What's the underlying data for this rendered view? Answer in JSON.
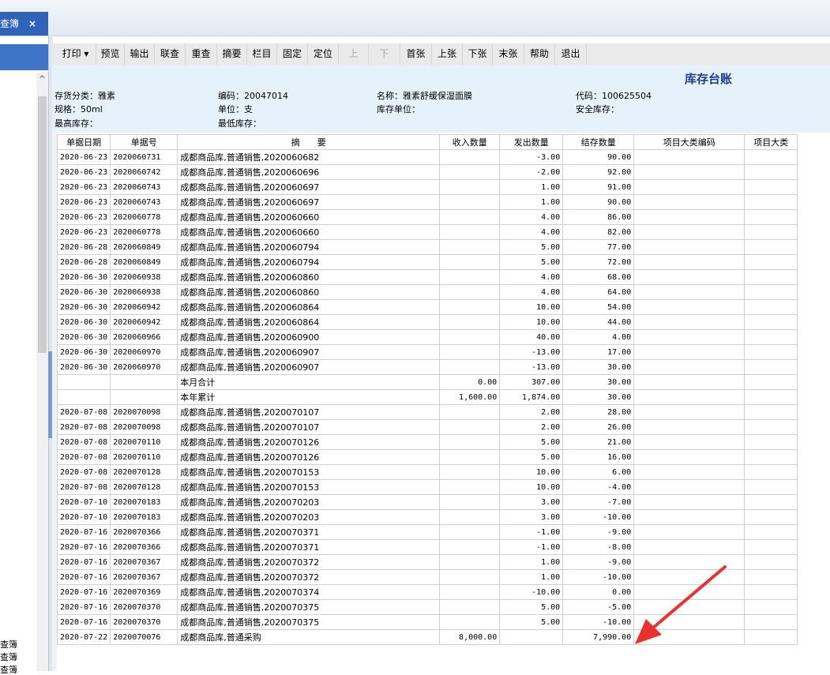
{
  "tab": {
    "label": "查簿",
    "close": "×"
  },
  "left_panel": {
    "items": [
      "查簿",
      "查簿",
      "查簿"
    ]
  },
  "toolbar": [
    {
      "label": "打印 ▾",
      "enabled": true
    },
    {
      "label": "预览",
      "enabled": true
    },
    {
      "label": "输出",
      "enabled": true
    },
    {
      "label": "联查",
      "enabled": true
    },
    {
      "label": "重查",
      "enabled": true
    },
    {
      "label": "摘要",
      "enabled": true
    },
    {
      "label": "栏目",
      "enabled": true
    },
    {
      "label": "固定",
      "enabled": true
    },
    {
      "label": "定位",
      "enabled": true
    },
    {
      "label": "上",
      "enabled": false
    },
    {
      "label": "下",
      "enabled": false
    },
    {
      "label": "首张",
      "enabled": true
    },
    {
      "label": "上张",
      "enabled": true
    },
    {
      "label": "下张",
      "enabled": true
    },
    {
      "label": "末张",
      "enabled": true
    },
    {
      "label": "帮助",
      "enabled": true
    },
    {
      "label": "退出",
      "enabled": true
    }
  ],
  "header": {
    "title": "库存台账",
    "category": "存货分类：雅素",
    "code": "编码：20047014",
    "name": "名称：雅素舒缓保湿面膜",
    "daima": "代码：100625504",
    "spec": "规格：50ml",
    "unit": "单位：支",
    "stock_unit": "库存单位：",
    "safety_stock": "安全库存：",
    "max_stock": "最高库存：",
    "min_stock": "最低库存："
  },
  "table": {
    "columns": [
      "单据日期",
      "单据号",
      "摘　　要",
      "收入数量",
      "发出数量",
      "结存数量",
      "项目大类编码",
      "项目大类"
    ],
    "rows": [
      [
        "2020-06-23",
        "2020060731",
        "成都商品库,普通销售,2020060682",
        "",
        "-3.00",
        "90.00",
        "",
        ""
      ],
      [
        "2020-06-23",
        "2020060742",
        "成都商品库,普通销售,2020060696",
        "",
        "-2.00",
        "92.00",
        "",
        ""
      ],
      [
        "2020-06-23",
        "2020060743",
        "成都商品库,普通销售,2020060697",
        "",
        "1.00",
        "91.00",
        "",
        ""
      ],
      [
        "2020-06-23",
        "2020060743",
        "成都商品库,普通销售,2020060697",
        "",
        "1.00",
        "90.00",
        "",
        ""
      ],
      [
        "2020-06-23",
        "2020060778",
        "成都商品库,普通销售,2020060660",
        "",
        "4.00",
        "86.00",
        "",
        ""
      ],
      [
        "2020-06-23",
        "2020060778",
        "成都商品库,普通销售,2020060660",
        "",
        "4.00",
        "82.00",
        "",
        ""
      ],
      [
        "2020-06-28",
        "2020060849",
        "成都商品库,普通销售,2020060794",
        "",
        "5.00",
        "77.00",
        "",
        ""
      ],
      [
        "2020-06-28",
        "2020060849",
        "成都商品库,普通销售,2020060794",
        "",
        "5.00",
        "72.00",
        "",
        ""
      ],
      [
        "2020-06-30",
        "2020060938",
        "成都商品库,普通销售,2020060860",
        "",
        "4.00",
        "68.00",
        "",
        ""
      ],
      [
        "2020-06-30",
        "2020060938",
        "成都商品库,普通销售,2020060860",
        "",
        "4.00",
        "64.00",
        "",
        ""
      ],
      [
        "2020-06-30",
        "2020060942",
        "成都商品库,普通销售,2020060864",
        "",
        "10.00",
        "54.00",
        "",
        ""
      ],
      [
        "2020-06-30",
        "2020060942",
        "成都商品库,普通销售,2020060864",
        "",
        "10.00",
        "44.00",
        "",
        ""
      ],
      [
        "2020-06-30",
        "2020060966",
        "成都商品库,普通销售,2020060900",
        "",
        "40.00",
        "4.00",
        "",
        ""
      ],
      [
        "2020-06-30",
        "2020060970",
        "成都商品库,普通销售,2020060907",
        "",
        "-13.00",
        "17.00",
        "",
        ""
      ],
      [
        "2020-06-30",
        "2020060970",
        "成都商品库,普通销售,2020060907",
        "",
        "-13.00",
        "30.00",
        "",
        ""
      ],
      [
        "",
        "",
        "本月合计",
        "0.00",
        "307.00",
        "30.00",
        "",
        ""
      ],
      [
        "",
        "",
        "本年累计",
        "1,600.00",
        "1,874.00",
        "30.00",
        "",
        ""
      ],
      [
        "2020-07-08",
        "2020070098",
        "成都商品库,普通销售,2020070107",
        "",
        "2.00",
        "28.00",
        "",
        ""
      ],
      [
        "2020-07-08",
        "2020070098",
        "成都商品库,普通销售,2020070107",
        "",
        "2.00",
        "26.00",
        "",
        ""
      ],
      [
        "2020-07-08",
        "2020070110",
        "成都商品库,普通销售,2020070126",
        "",
        "5.00",
        "21.00",
        "",
        ""
      ],
      [
        "2020-07-08",
        "2020070110",
        "成都商品库,普通销售,2020070126",
        "",
        "5.00",
        "16.00",
        "",
        ""
      ],
      [
        "2020-07-08",
        "2020070128",
        "成都商品库,普通销售,2020070153",
        "",
        "10.00",
        "6.00",
        "",
        ""
      ],
      [
        "2020-07-08",
        "2020070128",
        "成都商品库,普通销售,2020070153",
        "",
        "10.00",
        "-4.00",
        "",
        ""
      ],
      [
        "2020-07-10",
        "2020070183",
        "成都商品库,普通销售,2020070203",
        "",
        "3.00",
        "-7.00",
        "",
        ""
      ],
      [
        "2020-07-10",
        "2020070183",
        "成都商品库,普通销售,2020070203",
        "",
        "3.00",
        "-10.00",
        "",
        ""
      ],
      [
        "2020-07-16",
        "2020070366",
        "成都商品库,普通销售,2020070371",
        "",
        "-1.00",
        "-9.00",
        "",
        ""
      ],
      [
        "2020-07-16",
        "2020070366",
        "成都商品库,普通销售,2020070371",
        "",
        "-1.00",
        "-8.00",
        "",
        ""
      ],
      [
        "2020-07-16",
        "2020070367",
        "成都商品库,普通销售,2020070372",
        "",
        "1.00",
        "-9.00",
        "",
        ""
      ],
      [
        "2020-07-16",
        "2020070367",
        "成都商品库,普通销售,2020070372",
        "",
        "1.00",
        "-10.00",
        "",
        ""
      ],
      [
        "2020-07-16",
        "2020070369",
        "成都商品库,普通销售,2020070374",
        "",
        "-10.00",
        "0.00",
        "",
        ""
      ],
      [
        "2020-07-16",
        "2020070370",
        "成都商品库,普通销售,2020070375",
        "",
        "5.00",
        "-5.00",
        "",
        ""
      ],
      [
        "2020-07-16",
        "2020070370",
        "成都商品库,普通销售,2020070375",
        "",
        "5.00",
        "-10.00",
        "",
        ""
      ],
      [
        "2020-07-22",
        "2020070076",
        "成都商品库,普通采购",
        "8,000.00",
        "",
        "7,990.00",
        "",
        ""
      ]
    ]
  },
  "annotation": {
    "arrow_color": "#e8322f"
  }
}
